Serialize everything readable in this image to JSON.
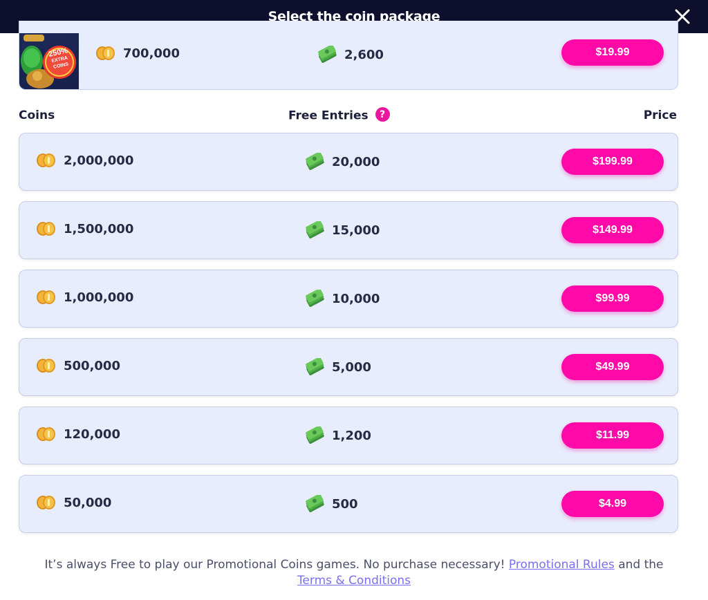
{
  "header": {
    "title": "Select the coin package"
  },
  "featured": {
    "badge_lines": [
      "250%",
      "EXTRA",
      "COINS"
    ],
    "coins": "700,000",
    "entries": "2,600",
    "price": "$19.99"
  },
  "columns": {
    "coins": "Coins",
    "entries": "Free Entries",
    "price": "Price"
  },
  "packages": [
    {
      "coins": "2,000,000",
      "entries": "20,000",
      "price": "$199.99"
    },
    {
      "coins": "1,500,000",
      "entries": "15,000",
      "price": "$149.99"
    },
    {
      "coins": "1,000,000",
      "entries": "10,000",
      "price": "$99.99"
    },
    {
      "coins": "500,000",
      "entries": "5,000",
      "price": "$49.99"
    },
    {
      "coins": "120,000",
      "entries": "1,200",
      "price": "$11.99"
    },
    {
      "coins": "50,000",
      "entries": "500",
      "price": "$4.99"
    }
  ],
  "footer": {
    "text": "It’s always Free to play our Promotional Coins games. No purchase necessary!",
    "rules_link": "Promotional Rules",
    "and_text": "and the",
    "terms_link": "Terms & Conditions"
  },
  "icons": {
    "close": "close-icon",
    "coin": "gold-coin-stack-icon",
    "cash": "cash-stack-icon",
    "help": "question-mark-icon"
  },
  "colors": {
    "header_bg": "#0d0f2c",
    "row_bg": "#e7edfc",
    "price_button": "#ff0aa9",
    "link": "#7a6ff0"
  }
}
